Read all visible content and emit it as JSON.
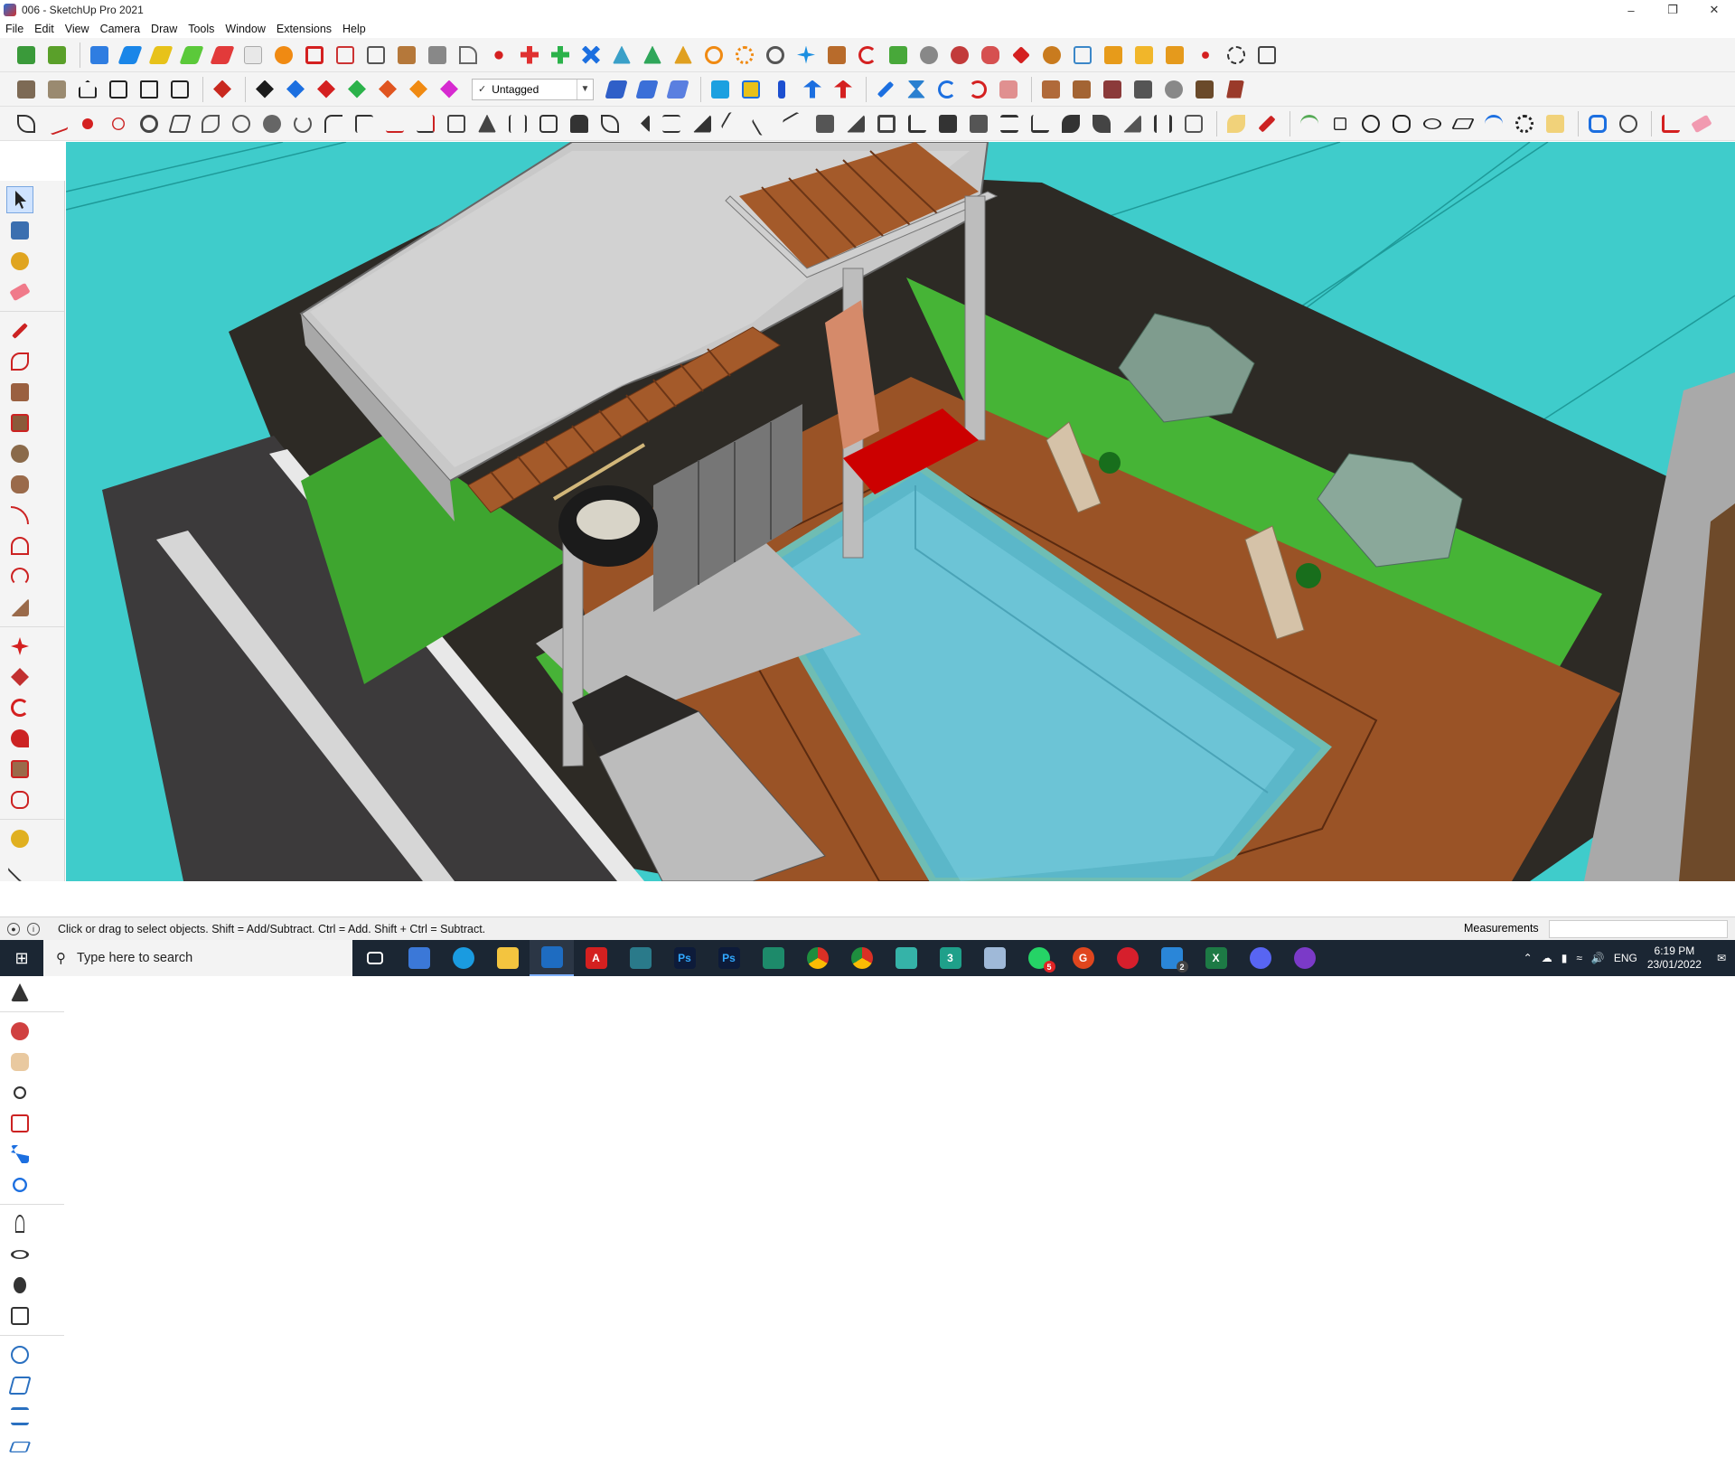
{
  "window": {
    "title": "006 - SketchUp Pro 2021",
    "controls": [
      "minimize-icon",
      "restore-icon",
      "close-icon"
    ]
  },
  "menu": [
    "File",
    "Edit",
    "View",
    "Camera",
    "Draw",
    "Tools",
    "Window",
    "Extensions",
    "Help"
  ],
  "toolbar": {
    "tag_selector": {
      "value": "Untagged"
    },
    "colors": {
      "accent_red": "#d42020",
      "accent_blue": "#1c6fe0",
      "accent_green": "#2bb24a",
      "accent_orange": "#f08a12"
    }
  },
  "status": {
    "hint": "Click or drag to select objects. Shift = Add/Subtract. Ctrl = Add. Shift + Ctrl = Subtract.",
    "measurements_label": "Measurements"
  },
  "taskbar": {
    "search_placeholder": "Type here to search",
    "apps": [
      "task-view",
      "calculator",
      "edge",
      "file-explorer",
      "sketchup",
      "acrobat",
      "snip",
      "photoshop",
      "photoshop-2",
      "app-green",
      "chrome",
      "chrome-2",
      "sketchup-2",
      "three",
      "app-blue",
      "whatsapp",
      "grammarly",
      "opera",
      "vscode",
      "excel",
      "discord",
      "podcast"
    ],
    "whatsapp_badge": "5",
    "vscode_badge": "2",
    "language": "ENG",
    "time": "6:19 PM",
    "date": "23/01/2022"
  }
}
